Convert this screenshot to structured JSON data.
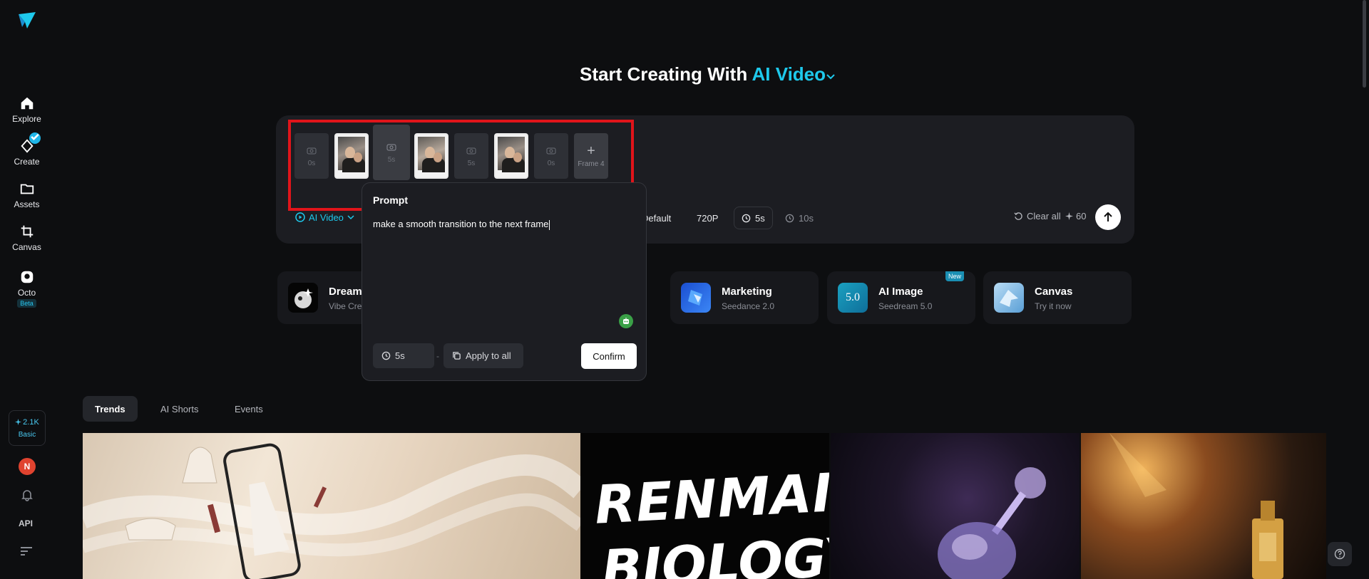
{
  "sidebar": {
    "items": [
      {
        "label": "Explore",
        "icon": "home-icon"
      },
      {
        "label": "Create",
        "icon": "diamond-icon"
      },
      {
        "label": "Assets",
        "icon": "folder-icon"
      },
      {
        "label": "Canvas",
        "icon": "crop-icon"
      },
      {
        "label": "Octo",
        "icon": "octo-icon",
        "badge": "Beta"
      }
    ],
    "credits": "2.1K",
    "plan": "Basic",
    "avatar_letter": "N",
    "api_label": "API"
  },
  "header": {
    "title_prefix": "Start Creating With",
    "title_accent": "AI Video"
  },
  "panel": {
    "frames": [
      {
        "type": "duration",
        "label": "0s"
      },
      {
        "type": "image"
      },
      {
        "type": "duration",
        "label": "5s",
        "selected": true
      },
      {
        "type": "image"
      },
      {
        "type": "duration",
        "label": "5s"
      },
      {
        "type": "image"
      },
      {
        "type": "duration",
        "label": "0s"
      },
      {
        "type": "add",
        "label": "Frame 4"
      }
    ],
    "mode_label": "AI Video",
    "ratio_label": "Default",
    "resolution_label": "720P",
    "duration_selected": "5s",
    "duration_alt": "10s",
    "clear_label": "Clear all",
    "credit_cost": "60"
  },
  "cards": [
    {
      "title": "Dreami",
      "subtitle": "Vibe Cre"
    },
    {
      "title": "Marketing",
      "subtitle": "Seedance 2.0"
    },
    {
      "title": "AI Image",
      "subtitle": "Seedream 5.0",
      "badge": "New",
      "thumb_text": "5.0"
    },
    {
      "title": "Canvas",
      "subtitle": "Try it now"
    }
  ],
  "prompt_popover": {
    "title": "Prompt",
    "text": "make a smooth transition to the next frame",
    "duration": "5s",
    "separator": "-",
    "apply_label": "Apply to all",
    "confirm_label": "Confirm"
  },
  "tabs": [
    {
      "label": "Trends",
      "active": true
    },
    {
      "label": "AI Shorts"
    },
    {
      "label": "Events"
    }
  ],
  "gallery": {
    "renmai_line1": "RENMAI",
    "renmai_line2": "BIOLOGY"
  },
  "colors": {
    "accent": "#1ec9ec",
    "highlight": "#e0141a",
    "background": "#0d0e10"
  }
}
